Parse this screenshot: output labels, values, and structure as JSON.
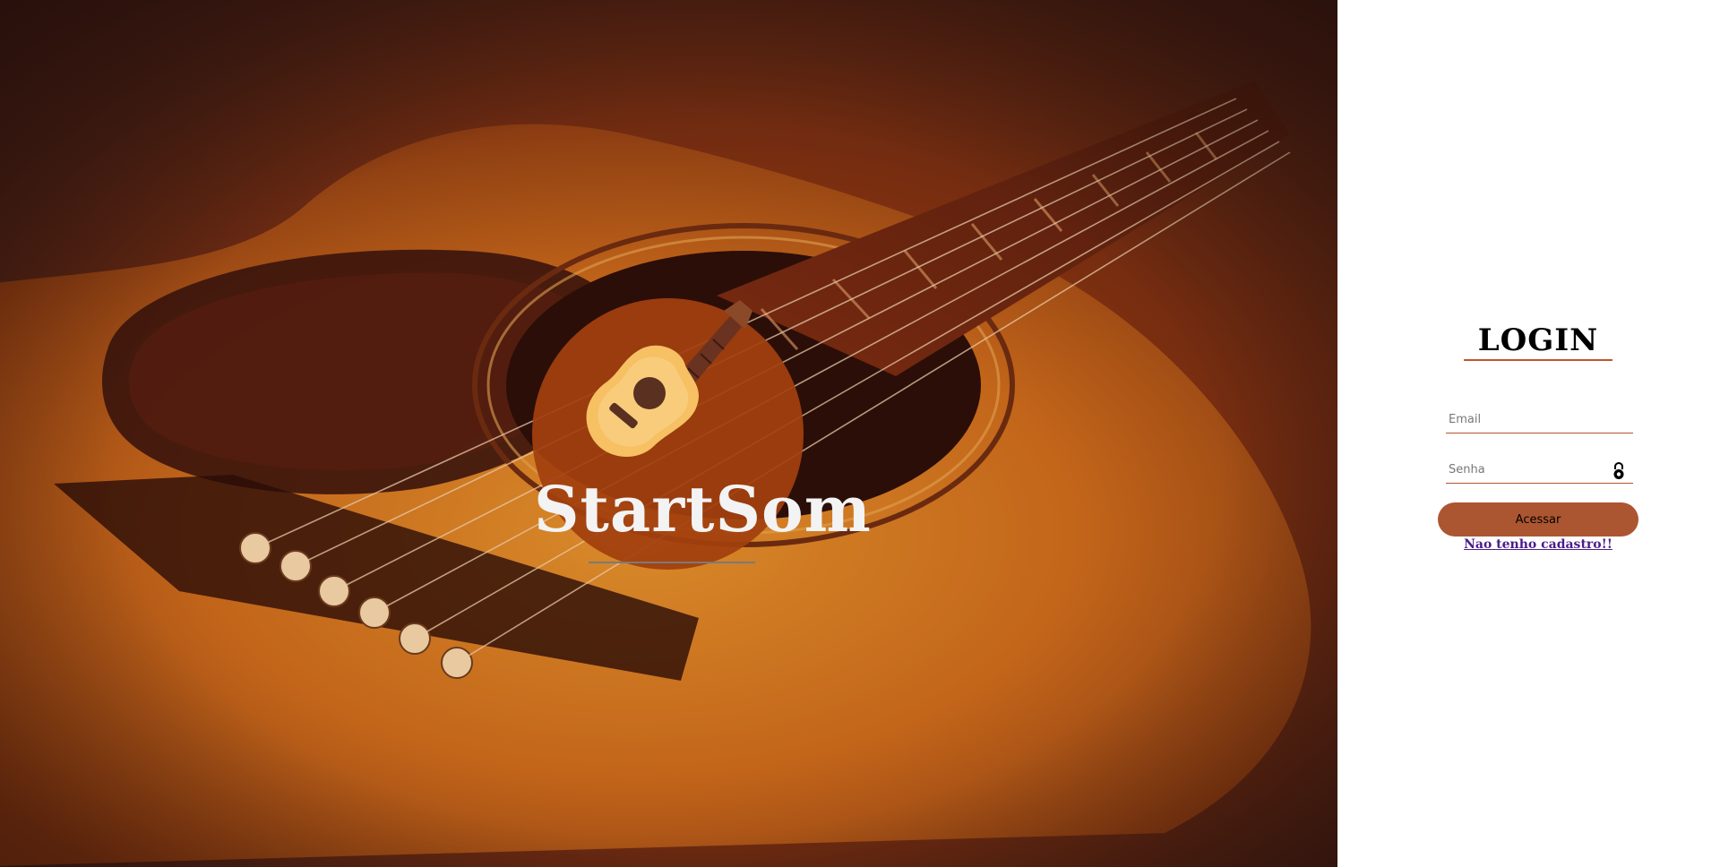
{
  "colors": {
    "hero_dark": "#3a1a12",
    "hero_mid": "#a8450f",
    "brand_circle": "#a2400f",
    "accent": "#ac5631",
    "underline": "#c2552d",
    "link": "#4b1c8a"
  },
  "hero": {
    "brand_name": "StartSom",
    "brand_icon": "acoustic-guitar-icon",
    "background": "acoustic-guitar-photo"
  },
  "login": {
    "title": "LOGIN",
    "email": {
      "placeholder": "Email",
      "value": ""
    },
    "senha": {
      "placeholder": "Senha",
      "value": "",
      "icon": "lock-icon"
    },
    "submit_label": "Acessar",
    "signup_link": "Nao tenho cadastro!!"
  }
}
